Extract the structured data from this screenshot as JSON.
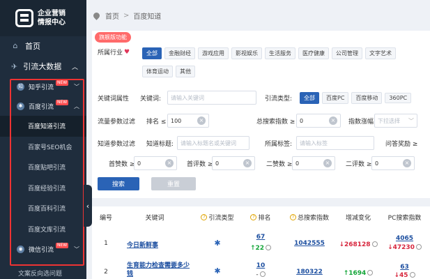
{
  "logo": {
    "line1": "企业营销",
    "line2": "情报中心"
  },
  "sidebar": {
    "home": "首页",
    "traffic": "引流大数据",
    "zhihu": "知乎引流",
    "baidu": "百度引流",
    "new_badge": "NEW",
    "items": [
      "百度知道引流",
      "百家号SEO机会",
      "百度贴吧引流",
      "百度经验引流",
      "百度百科引流",
      "百度文库引流"
    ],
    "wechat": "微信引流",
    "bottom": "文案反向选问题"
  },
  "breadcrumb": {
    "home": "首页",
    "current": "百度知道"
  },
  "filters": {
    "new_badge": "旗舰版功能",
    "industry_label": "所属行业",
    "industries": [
      "全部",
      "金融财经",
      "游戏应用",
      "影视娱乐",
      "生活服务",
      "医疗健康",
      "公司管理",
      "文字艺术",
      "体育运动",
      "其他"
    ],
    "kw_attr_label": "关键词属性",
    "kw_label": "关键词:",
    "kw_placeholder": "请输入关键词",
    "traffic_type_label": "引流类型:",
    "traffic_types": [
      "全部",
      "百度PC",
      "百度移动",
      "360PC"
    ],
    "flow_label": "流量参数过滤",
    "rank_label": "排名 ≤",
    "rank_value": "100",
    "search_index_label": "总搜索指数 ≥",
    "search_index_value": "0",
    "index_change_label": "指数涨幅",
    "index_change_placeholder": "下拉选择",
    "zhidao_label": "知道参数过滤",
    "title_label": "知道标题:",
    "title_placeholder": "请输入标题名或关键词",
    "tag_label": "所属标签:",
    "tag_placeholder": "请输入标签",
    "answer_reward_label": "问答奖励 ≥",
    "likes_label": "首赞数 ≥",
    "likes_value": "0",
    "comments_label": "首评数 ≥",
    "comments_value": "0",
    "seconds_label": "二赞数 ≥",
    "seconds_value": "0",
    "second_comments_label": "二评数 ≥",
    "second_comments_value": "0",
    "search_btn": "搜索",
    "reset_btn": "重置"
  },
  "table": {
    "headers": [
      "编号",
      "关键词",
      "引流类型",
      "排名",
      "总搜索指数",
      "增减变化",
      "PC搜索指数"
    ],
    "rows": [
      {
        "no": "1",
        "keyword": "今日新鲜事",
        "rank": "67",
        "rank_change": "↑22",
        "index": "1042555",
        "change": "↓268128",
        "pc": "4065",
        "pc_change": "↓47230"
      },
      {
        "no": "2",
        "keyword": "生育能力检查需要多少钱",
        "rank": "10",
        "rank_change": "-",
        "index": "180322",
        "change": "↑1694",
        "pc": "63",
        "pc_change": "↓45"
      }
    ]
  }
}
